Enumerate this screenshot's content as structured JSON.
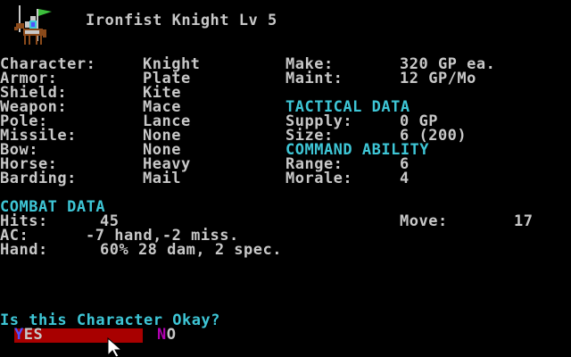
{
  "title": "Ironfist Knight Lv 5",
  "attributes": {
    "character_label": "Character:",
    "character_value": "Knight",
    "armor_label": "Armor:",
    "armor_value": "Plate",
    "shield_label": "Shield:",
    "shield_value": "Kite",
    "weapon_label": "Weapon:",
    "weapon_value": "Mace",
    "pole_label": "Pole:",
    "pole_value": "Lance",
    "missile_label": "Missile:",
    "missile_value": "None",
    "bow_label": "Bow:",
    "bow_value": "None",
    "horse_label": "Horse:",
    "horse_value": "Heavy",
    "barding_label": "Barding:",
    "barding_value": "Mail"
  },
  "cost": {
    "make_label": "Make:",
    "make_value": "320 GP ea.",
    "maint_label": "Maint:",
    "maint_value": "12 GP/Mo"
  },
  "tactical": {
    "header": "TACTICAL DATA",
    "supply_label": "Supply:",
    "supply_value": "0 GP",
    "size_label": "Size:",
    "size_value": "6 (200)"
  },
  "command": {
    "header": "COMMAND ABILITY",
    "range_label": "Range:",
    "range_value": "6",
    "morale_label": "Morale:",
    "morale_value": "4"
  },
  "combat": {
    "header": "COMBAT DATA",
    "hits_label": "Hits:",
    "hits_value": "45",
    "move_label": "Move:",
    "move_value": "17",
    "ac_label": "AC:",
    "ac_value": "-7 hand,-2 miss.",
    "hand_label": "Hand:",
    "hand_value": "60% 28 dam, 2 spec."
  },
  "prompt": {
    "question": "Is this Character Okay?",
    "yes_hotkey": "Y",
    "yes_rest": "ES",
    "no_hotkey": "N",
    "no_rest": "O"
  },
  "colors": {
    "text": "#c8c8c8",
    "header": "#3ec6d6",
    "selection_bar": "#a80000",
    "yes_hotkey": "#5050ff",
    "no_hotkey": "#b000b0"
  },
  "icons": {
    "unit_sprite": "mounted-knight-with-banner-icon",
    "cursor": "mouse-pointer-icon"
  }
}
